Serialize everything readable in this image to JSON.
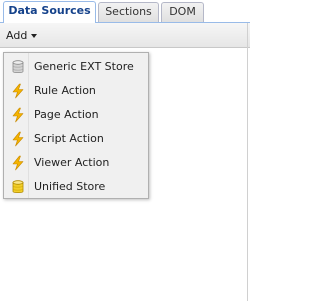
{
  "tabs": [
    {
      "label": "Data Sources",
      "active": true
    },
    {
      "label": "Sections",
      "active": false
    },
    {
      "label": "DOM",
      "active": false
    }
  ],
  "toolbar": {
    "add_label": "Add"
  },
  "menu": {
    "items": [
      {
        "label": "Generic EXT Store",
        "icon": "database-gray-icon"
      },
      {
        "label": "Rule Action",
        "icon": "lightning-icon"
      },
      {
        "label": "Page Action",
        "icon": "lightning-icon"
      },
      {
        "label": "Script Action",
        "icon": "lightning-icon"
      },
      {
        "label": "Viewer Action",
        "icon": "lightning-icon"
      },
      {
        "label": "Unified Store",
        "icon": "database-yellow-icon"
      }
    ]
  },
  "colors": {
    "tab_active_text": "#15428b",
    "tab_border": "#99bbe8",
    "lightning": "#f5b400",
    "db_gray": "#b8b8b8",
    "db_yellow": "#f2cf2a"
  }
}
